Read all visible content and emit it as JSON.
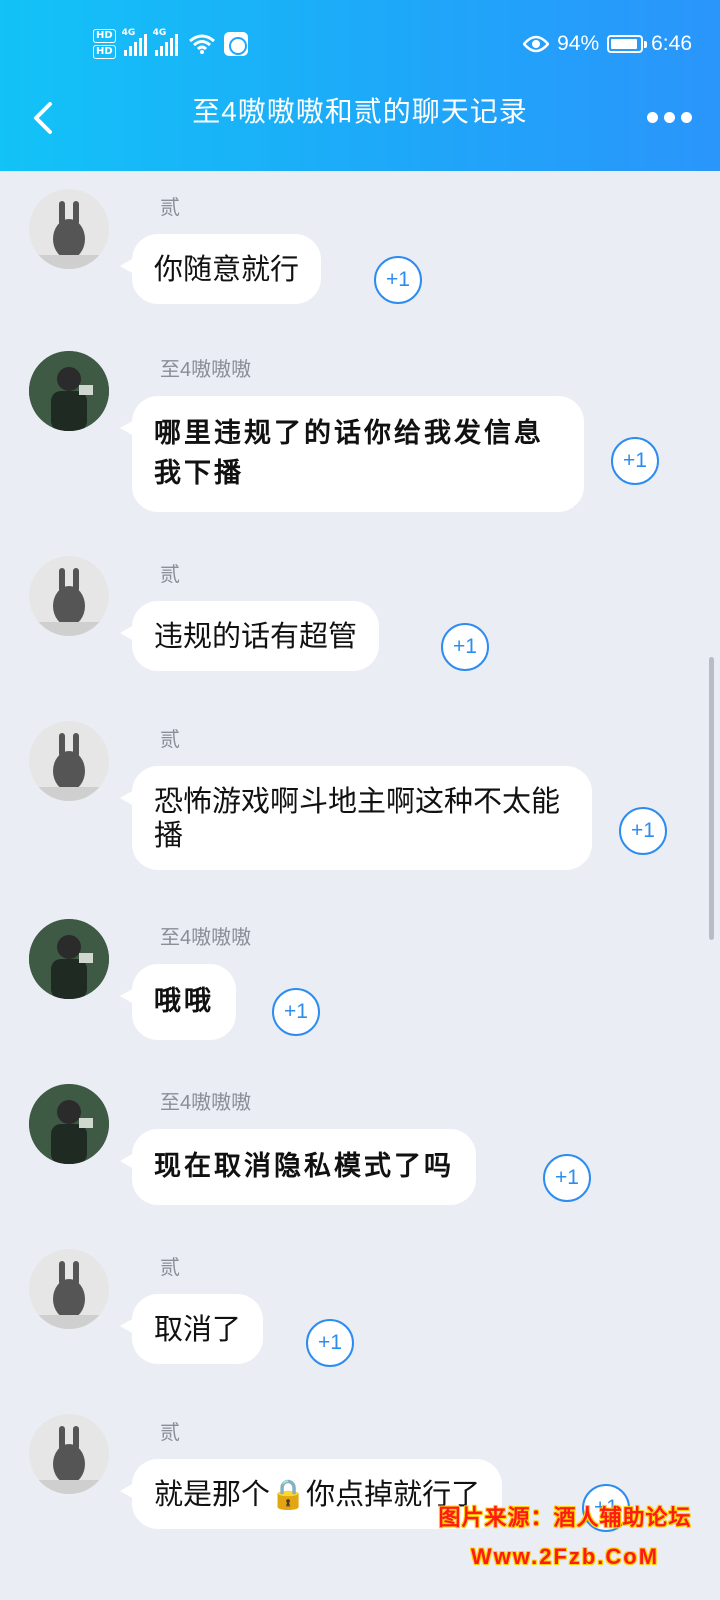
{
  "status_bar": {
    "hd1": "HD",
    "hd2": "HD",
    "net1": "4G",
    "net2": "4G",
    "battery_percent": "94%",
    "time": "6:46"
  },
  "header": {
    "title": "至4嗷嗷嗷和贰的聊天记录"
  },
  "messages": [
    {
      "sender": "贰",
      "text": "你随意就行",
      "plus": "+1",
      "avatar": "rabbit-avatar"
    },
    {
      "sender": "至4嗷嗷嗷",
      "text": "哪里违规了的话你给我发信息我下播",
      "plus": "+1",
      "avatar": "person-avatar"
    },
    {
      "sender": "贰",
      "text": "违规的话有超管",
      "plus": "+1",
      "avatar": "rabbit-avatar"
    },
    {
      "sender": "贰",
      "text": "恐怖游戏啊斗地主啊这种不太能播",
      "plus": "+1",
      "avatar": "rabbit-avatar"
    },
    {
      "sender": "至4嗷嗷嗷",
      "text": "哦哦",
      "plus": "+1",
      "avatar": "person-avatar"
    },
    {
      "sender": "至4嗷嗷嗷",
      "text": "现在取消隐私模式了吗",
      "plus": "+1",
      "avatar": "person-avatar"
    },
    {
      "sender": "贰",
      "text": "取消了",
      "plus": "+1",
      "avatar": "rabbit-avatar"
    },
    {
      "sender": "贰",
      "text": "就是那个🔒你点掉就行了",
      "plus": "+1",
      "avatar": "rabbit-avatar"
    }
  ],
  "watermark": {
    "line1": "图片来源：酒人辅助论坛",
    "line2": "Www.2Fzb.CoM"
  },
  "colors": {
    "header_start": "#12c3f7",
    "header_end": "#2a95fb",
    "background": "#eaedf4",
    "plus_one": "#2d8cf0"
  }
}
